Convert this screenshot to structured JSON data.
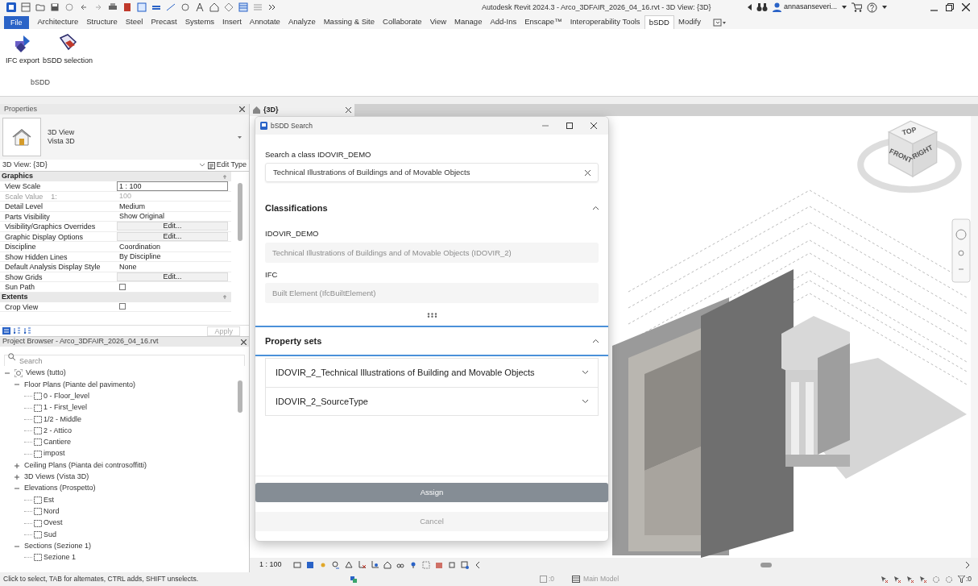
{
  "title_bar": {
    "title": "Autodesk Revit 2024.3 - Arco_3DFAIR_2026_04_16.rvt - 3D View: {3D}",
    "user": "annasanseveri..."
  },
  "ribbon": {
    "tabs": [
      {
        "label": "File",
        "kind": "app",
        "selected": false
      },
      {
        "label": "Architecture",
        "kind": "tab",
        "selected": false
      },
      {
        "label": "Structure",
        "kind": "tab",
        "selected": false
      },
      {
        "label": "Steel",
        "kind": "tab",
        "selected": false
      },
      {
        "label": "Precast",
        "kind": "tab",
        "selected": false
      },
      {
        "label": "Systems",
        "kind": "tab",
        "selected": false
      },
      {
        "label": "Insert",
        "kind": "tab",
        "selected": false
      },
      {
        "label": "Annotate",
        "kind": "tab",
        "selected": false
      },
      {
        "label": "Analyze",
        "kind": "tab",
        "selected": false
      },
      {
        "label": "Massing & Site",
        "kind": "tab",
        "selected": false
      },
      {
        "label": "Collaborate",
        "kind": "tab",
        "selected": false
      },
      {
        "label": "View",
        "kind": "tab",
        "selected": false
      },
      {
        "label": "Manage",
        "kind": "tab",
        "selected": false
      },
      {
        "label": "Add-Ins",
        "kind": "tab",
        "selected": false
      },
      {
        "label": "Enscape™",
        "kind": "tab",
        "selected": false
      },
      {
        "label": "Interoperability Tools",
        "kind": "tab",
        "selected": false
      },
      {
        "label": "bSDD",
        "kind": "tab",
        "selected": true
      },
      {
        "label": "Modify",
        "kind": "tab",
        "selected": false
      }
    ],
    "buttons": [
      {
        "label": "IFC export"
      },
      {
        "label": "bSDD selection"
      }
    ],
    "panel_label": "bSDD"
  },
  "properties": {
    "title": "Properties",
    "type_name": "3D View",
    "type_subname": "Vista 3D",
    "instance": "3D View: {3D}",
    "edit_type": "Edit Type",
    "groups": [
      {
        "name": "Graphics",
        "rows": [
          {
            "label": "View Scale",
            "kind": "input",
            "value": "1 : 100"
          },
          {
            "label": "Scale Value    1:",
            "kind": "readonly",
            "value": "100"
          },
          {
            "label": "Detail Level",
            "kind": "text",
            "value": "Medium"
          },
          {
            "label": "Parts Visibility",
            "kind": "text",
            "value": "Show Original"
          },
          {
            "label": "Visibility/Graphics Overrides",
            "kind": "button",
            "value": "Edit..."
          },
          {
            "label": "Graphic Display Options",
            "kind": "button",
            "value": "Edit..."
          },
          {
            "label": "Discipline",
            "kind": "text",
            "value": "Coordination"
          },
          {
            "label": "Show Hidden Lines",
            "kind": "text",
            "value": "By Discipline"
          },
          {
            "label": "Default Analysis Display Style",
            "kind": "text",
            "value": "None"
          },
          {
            "label": "Show Grids",
            "kind": "button",
            "value": "Edit..."
          },
          {
            "label": "Sun Path",
            "kind": "checkbox",
            "checked": false
          }
        ]
      },
      {
        "name": "Extents",
        "rows": [
          {
            "label": "Crop View",
            "kind": "checkbox",
            "checked": false
          }
        ]
      }
    ],
    "apply": "Apply"
  },
  "project_browser": {
    "title": "Project Browser - Arco_3DFAIR_2026_04_16.rvt",
    "search_placeholder": "Search",
    "tree": [
      {
        "label": "Views (tutto)",
        "expanded": true,
        "children": [
          {
            "label": "Floor Plans (Piante del pavimento)",
            "expanded": true,
            "children": [
              {
                "label": "0 - Floor_level"
              },
              {
                "label": "1 - First_level"
              },
              {
                "label": "1/2 - Middle"
              },
              {
                "label": "2 - Attico"
              },
              {
                "label": "Cantiere"
              },
              {
                "label": "impost"
              }
            ]
          },
          {
            "label": "Ceiling Plans (Pianta dei controsoffitti)",
            "expanded": false
          },
          {
            "label": "3D Views (Vista 3D)",
            "expanded": false
          },
          {
            "label": "Elevations (Prospetto)",
            "expanded": true,
            "children": [
              {
                "label": "Est"
              },
              {
                "label": "Nord"
              },
              {
                "label": "Ovest"
              },
              {
                "label": "Sud"
              }
            ]
          },
          {
            "label": "Sections (Sezione 1)",
            "expanded": true,
            "children": [
              {
                "label": "Sezione 1"
              }
            ]
          }
        ]
      }
    ]
  },
  "view": {
    "tab": "{3D}",
    "scale": "1 : 100",
    "cube_faces": [
      "TOP",
      "FRONT",
      "RIGHT"
    ]
  },
  "dialog": {
    "title": "bSDD Search",
    "search_label": "Search a class IDOVIR_DEMO",
    "search_value": "Technical Illustrations of Buildings and of Movable Objects",
    "classifications": {
      "title": "Classifications",
      "expanded": true,
      "fields": [
        {
          "label": "IDOVIR_DEMO",
          "value": "Technical Illustrations of Buildings and of Movable Objects (IDOVIR_2)"
        },
        {
          "label": "IFC",
          "value": "Built Element (IfcBuiltElement)"
        }
      ]
    },
    "property_sets": {
      "title": "Property sets",
      "expanded": true,
      "items": [
        {
          "label": "IDOVIR_2_Technical Illustrations of Building and Movable Objects",
          "expanded": false
        },
        {
          "label": "IDOVIR_2_SourceType",
          "expanded": false
        }
      ]
    },
    "assign": "Assign",
    "cancel": "Cancel"
  },
  "status_bar": {
    "hint": "Click to select, TAB for alternates, CTRL adds, SHIFT unselects.",
    "workset_count": ":0",
    "model": "Main Model",
    "filter_count": ":0"
  }
}
